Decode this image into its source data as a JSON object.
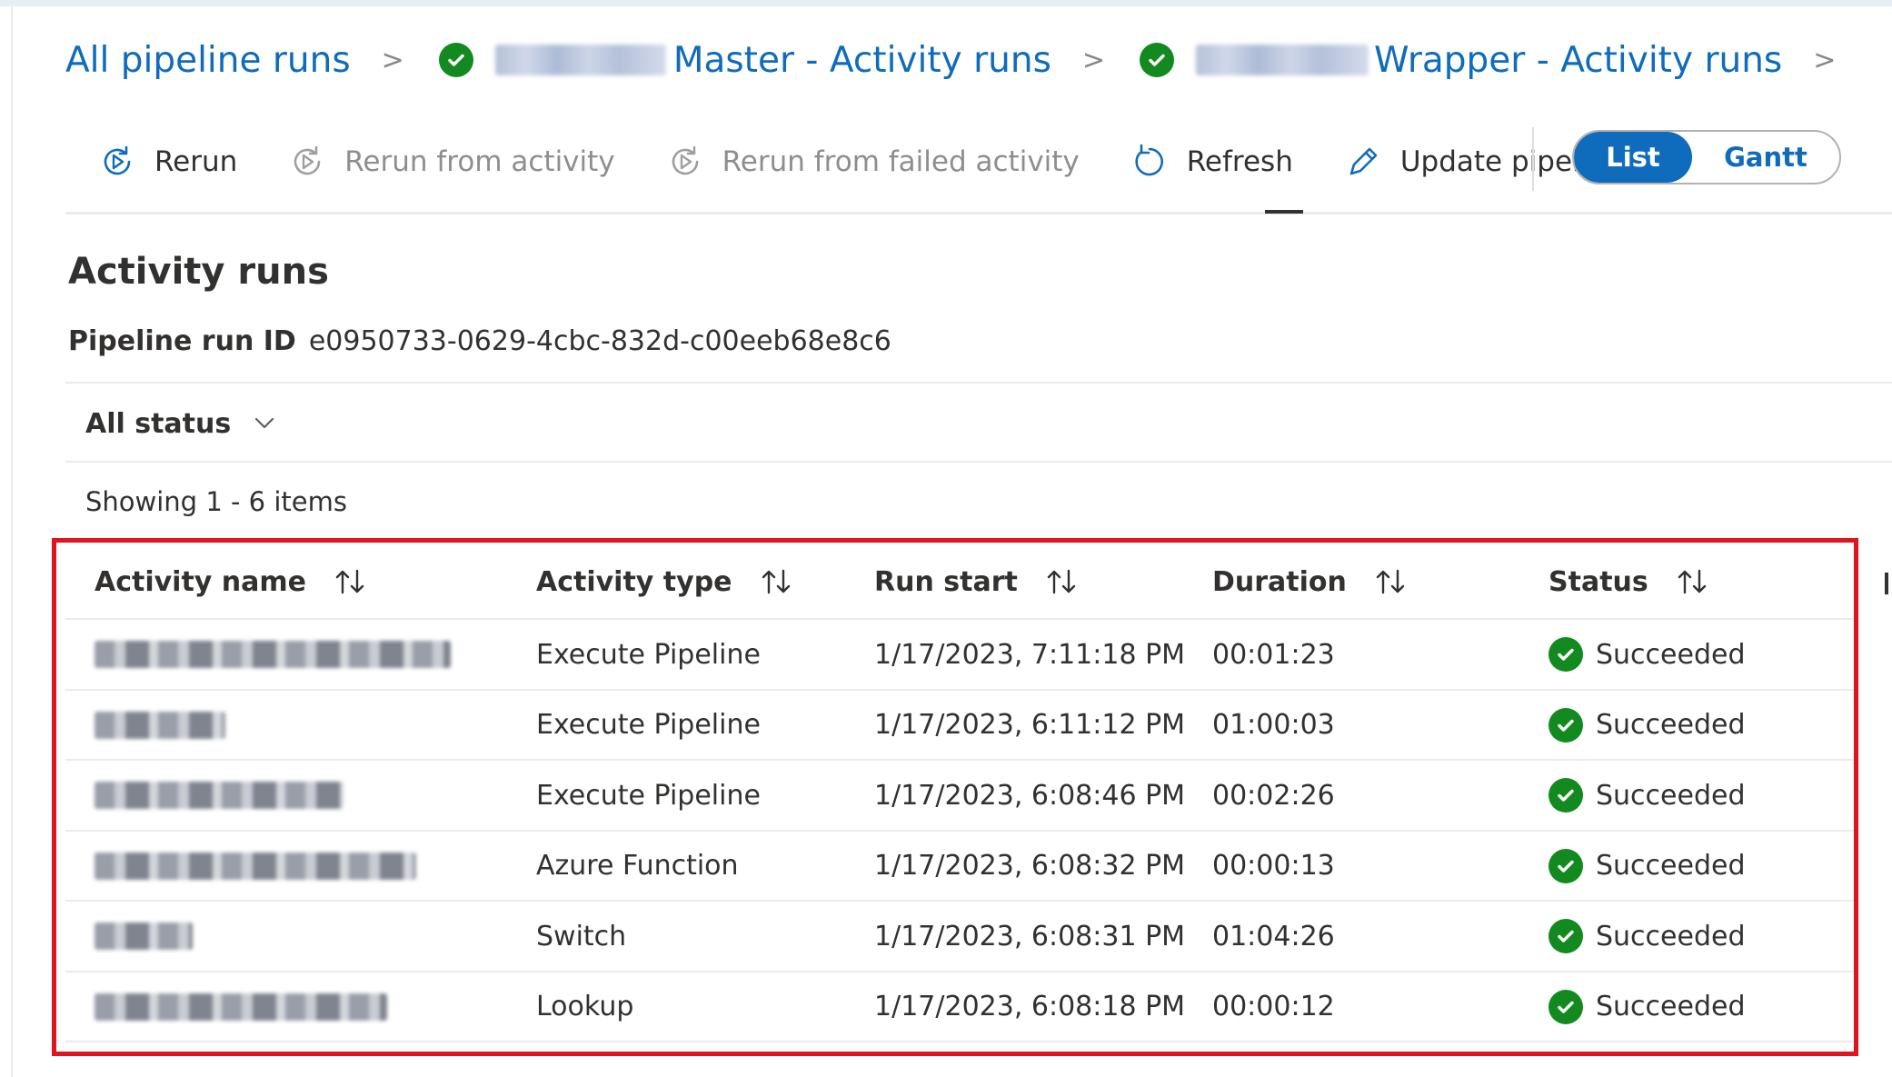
{
  "breadcrumb": {
    "root": "All pipeline runs",
    "level1_suffix": "Master - Activity runs",
    "level2_suffix": "Wrapper - Activity runs",
    "separator": ">"
  },
  "toolbar": {
    "rerun": "Rerun",
    "rerun_from_activity": "Rerun from activity",
    "rerun_from_failed": "Rerun from failed activity",
    "refresh": "Refresh",
    "update_pipeline": "Update pipeline",
    "view_list": "List",
    "view_gantt": "Gantt",
    "selected_view": "List"
  },
  "section": {
    "title": "Activity runs",
    "run_id_label": "Pipeline run ID",
    "run_id_value": "e0950733-0629-4cbc-832d-c00eeb68e8c6",
    "status_filter": "All status",
    "showing": "Showing 1 - 6 items"
  },
  "table": {
    "columns": [
      "Activity name",
      "Activity type",
      "Run start",
      "Duration",
      "Status"
    ],
    "rows": [
      {
        "type": "Execute Pipeline",
        "run_start": "1/17/2023, 7:11:18 PM",
        "duration": "00:01:23",
        "status": "Succeeded"
      },
      {
        "type": "Execute Pipeline",
        "run_start": "1/17/2023, 6:11:12 PM",
        "duration": "01:00:03",
        "status": "Succeeded"
      },
      {
        "type": "Execute Pipeline",
        "run_start": "1/17/2023, 6:08:46 PM",
        "duration": "00:02:26",
        "status": "Succeeded"
      },
      {
        "type": "Azure Function",
        "run_start": "1/17/2023, 6:08:32 PM",
        "duration": "00:00:13",
        "status": "Succeeded"
      },
      {
        "type": "Switch",
        "run_start": "1/17/2023, 6:08:31 PM",
        "duration": "01:04:26",
        "status": "Succeeded"
      },
      {
        "type": "Lookup",
        "run_start": "1/17/2023, 6:08:18 PM",
        "duration": "00:00:12",
        "status": "Succeeded"
      }
    ]
  },
  "colors": {
    "link": "#0f6cbd",
    "success": "#128a1f",
    "highlight": "#e0141e"
  },
  "icons": {
    "rerun": "rerun-icon",
    "rerun_from_activity": "rerun-from-activity-icon",
    "rerun_from_failed": "rerun-from-failed-icon",
    "refresh": "refresh-icon",
    "update_pipeline": "pencil-icon",
    "status": "check-circle-icon",
    "sort": "sort-arrows-icon",
    "filter": "chevron-down-icon"
  }
}
